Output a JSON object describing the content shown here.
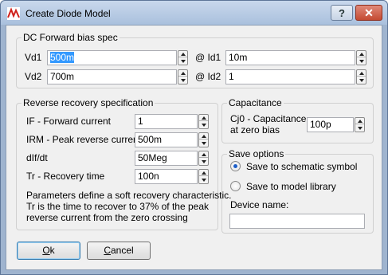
{
  "window": {
    "title": "Create Diode Model",
    "help_label": "?",
    "close_label": "✕",
    "accent": "#c44a32"
  },
  "dc": {
    "title": "DC Forward bias spec",
    "vd1_label": "Vd1",
    "vd1_value": "500m",
    "id1_label": "@ Id1",
    "id1_value": "10m",
    "vd2_label": "Vd2",
    "vd2_value": "700m",
    "id2_label": "@ Id2",
    "id2_value": "1"
  },
  "rr": {
    "title": "Reverse recovery specification",
    "if_label": "IF - Forward current",
    "if_value": "1",
    "irm_label": "IRM - Peak reverse current",
    "irm_value": "500m",
    "didt_label": "dIf/dt",
    "didt_value": "50Meg",
    "tr_label": "Tr - Recovery time",
    "tr_value": "100n",
    "note_line1": "Parameters define a soft recovery characteristic.",
    "note_line2": "Tr is the time to recover to 37% of the peak",
    "note_line3": "reverse current from the zero crossing"
  },
  "cap": {
    "title": "Capacitance",
    "cj0_line1": "Cj0 - Capacitance",
    "cj0_line2": "at zero bias",
    "cj0_value": "100p"
  },
  "save": {
    "title": "Save options",
    "opt_schematic": "Save to schematic symbol",
    "opt_library": "Save to model library",
    "device_name_label": "Device name:",
    "device_name_value": "",
    "selected": "schematic"
  },
  "buttons": {
    "ok_accel": "O",
    "ok_rest": "k",
    "cancel_accel": "C",
    "cancel_rest": "ancel"
  }
}
